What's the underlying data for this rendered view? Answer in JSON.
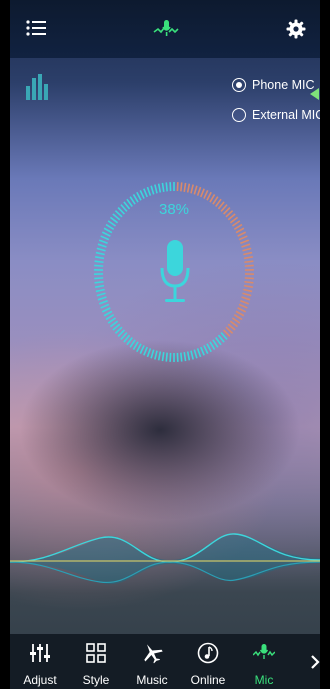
{
  "header": {
    "menu_icon": "hamburger-list-icon",
    "logo_icon": "mic-wave-logo-icon",
    "settings_icon": "gear-icon"
  },
  "eq_icon": "equalizer-bars-icon",
  "mic_source": {
    "options": [
      {
        "label": "Phone MIC",
        "selected": true
      },
      {
        "label": "External MIC",
        "selected": false
      }
    ]
  },
  "meter": {
    "percent_label": "38%",
    "level": 0.38
  },
  "nav": {
    "items": [
      {
        "label": "Adjust",
        "icon": "sliders-icon",
        "active": false
      },
      {
        "label": "Style",
        "icon": "grid-icon",
        "active": false
      },
      {
        "label": "Music",
        "icon": "airplane-icon",
        "active": false
      },
      {
        "label": "Online",
        "icon": "music-note-circle-icon",
        "active": false
      },
      {
        "label": "Mic",
        "icon": "mic-wave-icon",
        "active": true
      }
    ],
    "more_icon": "chevron-right-icon"
  },
  "colors": {
    "accent": "#3cd6dc",
    "meter_inactive": "#d98a6b",
    "active_tab": "#3ae07c",
    "selector_pointer": "#7fe07a"
  }
}
